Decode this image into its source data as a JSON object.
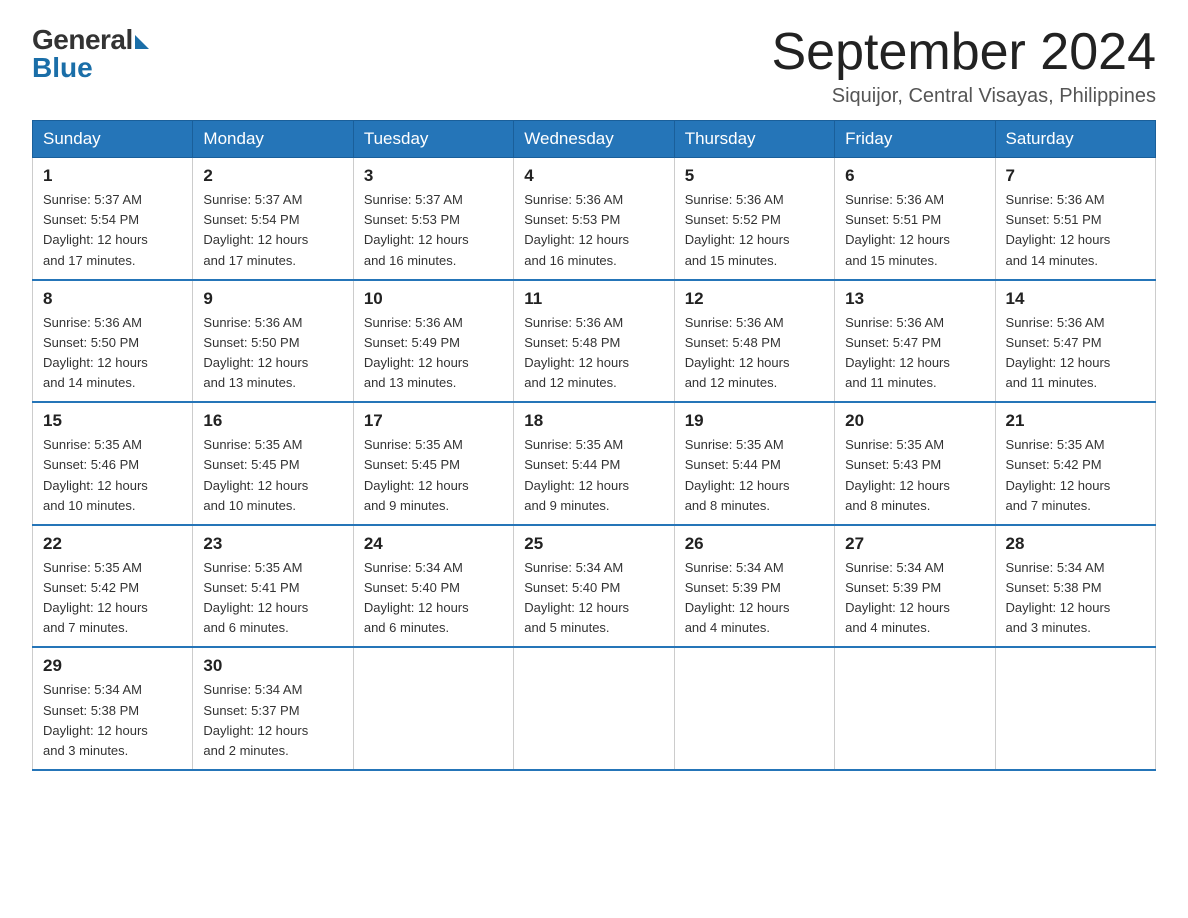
{
  "logo": {
    "general": "General",
    "blue": "Blue"
  },
  "header": {
    "month": "September 2024",
    "location": "Siquijor, Central Visayas, Philippines"
  },
  "days_of_week": [
    "Sunday",
    "Monday",
    "Tuesday",
    "Wednesday",
    "Thursday",
    "Friday",
    "Saturday"
  ],
  "weeks": [
    [
      {
        "day": "1",
        "sunrise": "5:37 AM",
        "sunset": "5:54 PM",
        "daylight": "12 hours and 17 minutes."
      },
      {
        "day": "2",
        "sunrise": "5:37 AM",
        "sunset": "5:54 PM",
        "daylight": "12 hours and 17 minutes."
      },
      {
        "day": "3",
        "sunrise": "5:37 AM",
        "sunset": "5:53 PM",
        "daylight": "12 hours and 16 minutes."
      },
      {
        "day": "4",
        "sunrise": "5:36 AM",
        "sunset": "5:53 PM",
        "daylight": "12 hours and 16 minutes."
      },
      {
        "day": "5",
        "sunrise": "5:36 AM",
        "sunset": "5:52 PM",
        "daylight": "12 hours and 15 minutes."
      },
      {
        "day": "6",
        "sunrise": "5:36 AM",
        "sunset": "5:51 PM",
        "daylight": "12 hours and 15 minutes."
      },
      {
        "day": "7",
        "sunrise": "5:36 AM",
        "sunset": "5:51 PM",
        "daylight": "12 hours and 14 minutes."
      }
    ],
    [
      {
        "day": "8",
        "sunrise": "5:36 AM",
        "sunset": "5:50 PM",
        "daylight": "12 hours and 14 minutes."
      },
      {
        "day": "9",
        "sunrise": "5:36 AM",
        "sunset": "5:50 PM",
        "daylight": "12 hours and 13 minutes."
      },
      {
        "day": "10",
        "sunrise": "5:36 AM",
        "sunset": "5:49 PM",
        "daylight": "12 hours and 13 minutes."
      },
      {
        "day": "11",
        "sunrise": "5:36 AM",
        "sunset": "5:48 PM",
        "daylight": "12 hours and 12 minutes."
      },
      {
        "day": "12",
        "sunrise": "5:36 AM",
        "sunset": "5:48 PM",
        "daylight": "12 hours and 12 minutes."
      },
      {
        "day": "13",
        "sunrise": "5:36 AM",
        "sunset": "5:47 PM",
        "daylight": "12 hours and 11 minutes."
      },
      {
        "day": "14",
        "sunrise": "5:36 AM",
        "sunset": "5:47 PM",
        "daylight": "12 hours and 11 minutes."
      }
    ],
    [
      {
        "day": "15",
        "sunrise": "5:35 AM",
        "sunset": "5:46 PM",
        "daylight": "12 hours and 10 minutes."
      },
      {
        "day": "16",
        "sunrise": "5:35 AM",
        "sunset": "5:45 PM",
        "daylight": "12 hours and 10 minutes."
      },
      {
        "day": "17",
        "sunrise": "5:35 AM",
        "sunset": "5:45 PM",
        "daylight": "12 hours and 9 minutes."
      },
      {
        "day": "18",
        "sunrise": "5:35 AM",
        "sunset": "5:44 PM",
        "daylight": "12 hours and 9 minutes."
      },
      {
        "day": "19",
        "sunrise": "5:35 AM",
        "sunset": "5:44 PM",
        "daylight": "12 hours and 8 minutes."
      },
      {
        "day": "20",
        "sunrise": "5:35 AM",
        "sunset": "5:43 PM",
        "daylight": "12 hours and 8 minutes."
      },
      {
        "day": "21",
        "sunrise": "5:35 AM",
        "sunset": "5:42 PM",
        "daylight": "12 hours and 7 minutes."
      }
    ],
    [
      {
        "day": "22",
        "sunrise": "5:35 AM",
        "sunset": "5:42 PM",
        "daylight": "12 hours and 7 minutes."
      },
      {
        "day": "23",
        "sunrise": "5:35 AM",
        "sunset": "5:41 PM",
        "daylight": "12 hours and 6 minutes."
      },
      {
        "day": "24",
        "sunrise": "5:34 AM",
        "sunset": "5:40 PM",
        "daylight": "12 hours and 6 minutes."
      },
      {
        "day": "25",
        "sunrise": "5:34 AM",
        "sunset": "5:40 PM",
        "daylight": "12 hours and 5 minutes."
      },
      {
        "day": "26",
        "sunrise": "5:34 AM",
        "sunset": "5:39 PM",
        "daylight": "12 hours and 4 minutes."
      },
      {
        "day": "27",
        "sunrise": "5:34 AM",
        "sunset": "5:39 PM",
        "daylight": "12 hours and 4 minutes."
      },
      {
        "day": "28",
        "sunrise": "5:34 AM",
        "sunset": "5:38 PM",
        "daylight": "12 hours and 3 minutes."
      }
    ],
    [
      {
        "day": "29",
        "sunrise": "5:34 AM",
        "sunset": "5:38 PM",
        "daylight": "12 hours and 3 minutes."
      },
      {
        "day": "30",
        "sunrise": "5:34 AM",
        "sunset": "5:37 PM",
        "daylight": "12 hours and 2 minutes."
      },
      null,
      null,
      null,
      null,
      null
    ]
  ]
}
